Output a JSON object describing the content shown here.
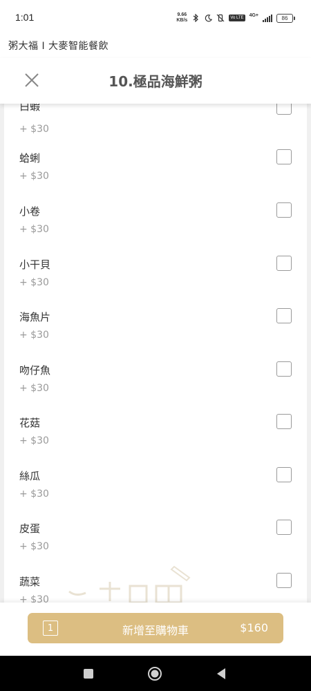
{
  "status_bar": {
    "time": "1:01",
    "net_speed_value": "9.66",
    "net_speed_unit": "KB/s",
    "network_type": "4G+",
    "volte": "Vo LTE",
    "battery": "86"
  },
  "store": {
    "title": "粥大福 I 大麥智能餐飲"
  },
  "header": {
    "title": "10.極品海鮮粥"
  },
  "options": [
    {
      "name": "白蝦",
      "price": "+ $30"
    },
    {
      "name": "蛤蜊",
      "price": "+ $30"
    },
    {
      "name": "小卷",
      "price": "+ $30"
    },
    {
      "name": "小干貝",
      "price": "+ $30"
    },
    {
      "name": "海魚片",
      "price": "+ $30"
    },
    {
      "name": "吻仔魚",
      "price": "+ $30"
    },
    {
      "name": "花菇",
      "price": "+ $30"
    },
    {
      "name": "絲瓜",
      "price": "+ $30"
    },
    {
      "name": "皮蛋",
      "price": "+ $30"
    },
    {
      "name": "蔬菜",
      "price": "+ $30"
    }
  ],
  "cart": {
    "quantity": "1",
    "label": "新增至購物車",
    "total": "$160"
  },
  "colors": {
    "accent": "#dcbe82",
    "price_text": "#9a9a9a",
    "list_background": "#f0f0f0"
  }
}
